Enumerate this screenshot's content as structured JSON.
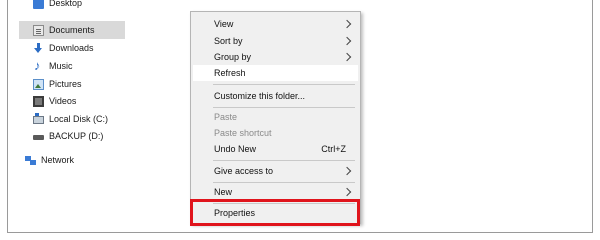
{
  "navigation": {
    "items": [
      {
        "label": "Desktop",
        "icon": "desktop-folder-icon"
      },
      {
        "label": "Documents",
        "icon": "documents-folder-icon",
        "selected": true
      },
      {
        "label": "Downloads",
        "icon": "downloads-icon"
      },
      {
        "label": "Music",
        "icon": "music-icon"
      },
      {
        "label": "Pictures",
        "icon": "pictures-icon"
      },
      {
        "label": "Videos",
        "icon": "videos-icon"
      },
      {
        "label": "Local Disk (C:)",
        "icon": "local-disk-icon"
      },
      {
        "label": "BACKUP (D:)",
        "icon": "drive-icon"
      },
      {
        "label": "Network",
        "icon": "network-icon"
      }
    ]
  },
  "context_menu": {
    "view": "View",
    "sort_by": "Sort by",
    "group_by": "Group by",
    "refresh": "Refresh",
    "customize": "Customize this folder...",
    "paste": "Paste",
    "paste_shortcut": "Paste shortcut",
    "undo_new": "Undo New",
    "undo_shortcut": "Ctrl+Z",
    "give_access": "Give access to",
    "new": "New",
    "properties": "Properties"
  },
  "colors": {
    "highlight_box": "#e0141c",
    "menu_background": "#f0f0f0",
    "selected_nav": "#d9d9d9"
  }
}
